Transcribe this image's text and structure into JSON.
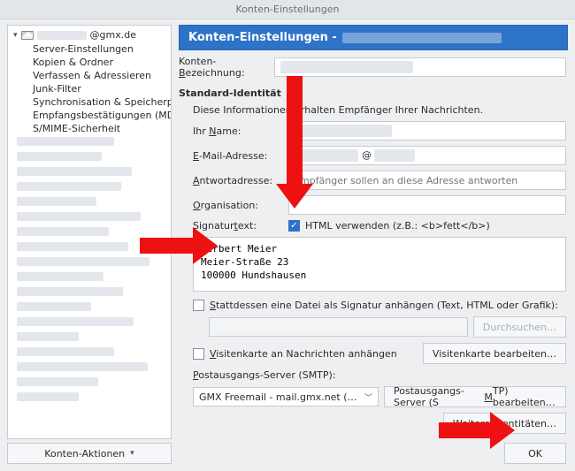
{
  "window": {
    "title": "Konten-Einstellungen"
  },
  "sidebar": {
    "account_domain": "@gmx.de",
    "items": [
      "Server-Einstellungen",
      "Kopien & Ordner",
      "Verfassen & Adressieren",
      "Junk-Filter",
      "Synchronisation & Speicherplatz",
      "Empfangsbestätigungen (MDN)",
      "S/MIME-Sicherheit"
    ],
    "actions_label": "Konten-Aktionen"
  },
  "header": {
    "title": "Konten-Einstellungen -"
  },
  "labels": {
    "konten_bezeichnung": "Konten-Bezeichnung:",
    "standard_identitaet": "Standard-Identität",
    "standard_subtext": "Diese Informationen erhalten Empfänger Ihrer Nachrichten.",
    "ihr_name": "Ihr Name:",
    "email": "E-Mail-Adresse:",
    "antwortadresse": "Antwortadresse:",
    "organisation": "Organisation:",
    "signaturtext": "Signaturtext:",
    "html_verwenden": "HTML verwenden (z.B.: <b>fett</b>)",
    "stattdessen_datei": "Stattdessen eine Datei als Signatur anhängen (Text, HTML oder Grafik):",
    "durchsuchen": "Durchsuchen…",
    "visitenkarte_anhaengen": "Visitenkarte an Nachrichten anhängen",
    "visitenkarte_bearbeiten": "Visitenkarte bearbeiten…",
    "postausgang": "Postausgangs-Server (SMTP):",
    "smtp_bearbeiten": "Postausgangs-Server (SMTP) bearbeiten…",
    "weitere_identitaeten": "Weitere Identitäten…",
    "ok": "OK"
  },
  "values": {
    "antwort_placeholder": "Empfänger sollen an diese Adresse antworten",
    "signature": "Herbert Meier\nMeier-Straße 23\n100000 Hundshausen",
    "smtp_selected": "GMX Freemail - mail.gmx.net (Stand…",
    "email_at": "@"
  },
  "checks": {
    "html": true,
    "file_sig": false,
    "vcard": false
  }
}
